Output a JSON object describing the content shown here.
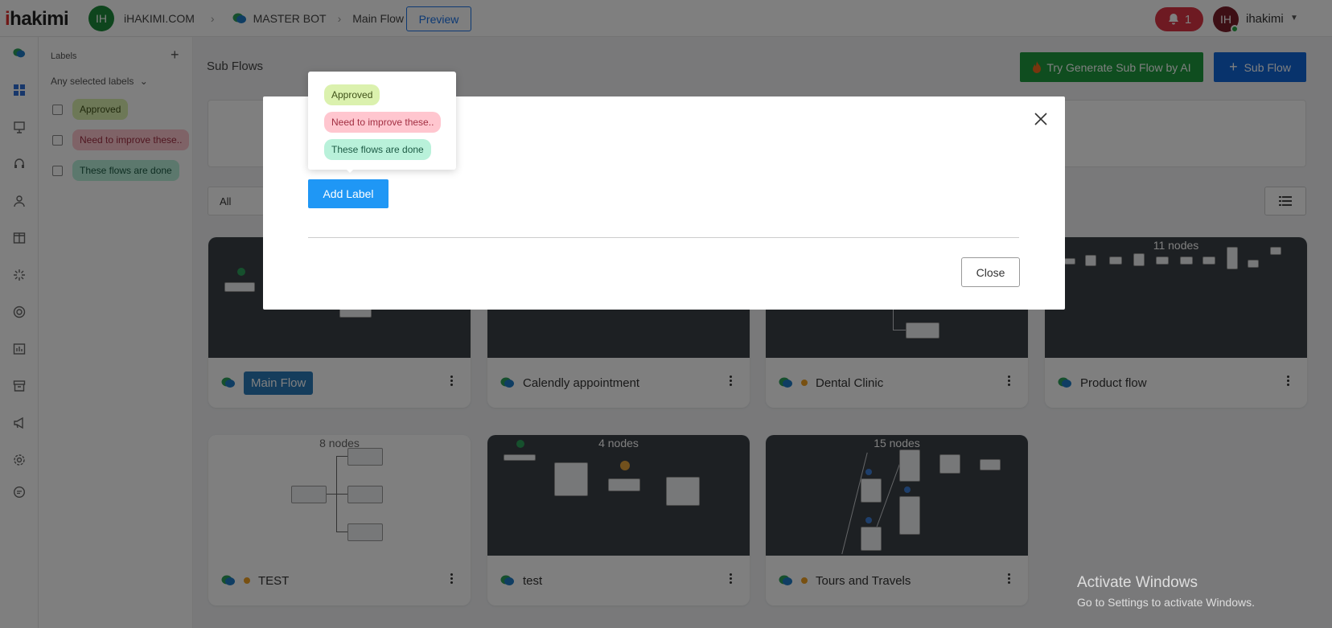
{
  "header": {
    "logo_prefix": "i",
    "logo_rest": "hakimi",
    "workspace_initials": "IH",
    "workspace_name": "iHAKIMI.COM",
    "bot_name": "MASTER BOT",
    "flow_name": "Main Flow",
    "preview_label": "Preview",
    "notification_count": "1",
    "user_initials": "IH",
    "user_name": "ihakimi"
  },
  "labels_panel": {
    "title": "Labels",
    "add": "+",
    "filter_placeholder": "Any selected labels",
    "items": [
      {
        "label": "Approved",
        "color": "#dbf1ae"
      },
      {
        "label": "Need to improve these..",
        "color": "#ffc6cf"
      },
      {
        "label": "These flows are done",
        "color": "#b9f1da"
      }
    ]
  },
  "main": {
    "title": "Sub Flows",
    "ai_button": "Try Generate Sub Flow by AI",
    "sub_flow_button": "Sub Flow",
    "filter_value": "All"
  },
  "cards": [
    {
      "name": "Main Flow",
      "nodes": ""
    },
    {
      "name": "Calendly appointment",
      "nodes": ""
    },
    {
      "name": "Dental Clinic",
      "nodes": ""
    },
    {
      "name": "Product flow",
      "nodes": "11 nodes"
    },
    {
      "name": "TEST",
      "nodes": "8 nodes"
    },
    {
      "name": "test",
      "nodes": "4 nodes"
    },
    {
      "name": "Tours and Travels",
      "nodes": "15 nodes"
    }
  ],
  "modal": {
    "add_label_button": "Add Label",
    "close_button": "Close",
    "popover_labels": [
      "Approved",
      "Need to improve these..",
      "These flows are done"
    ]
  },
  "watermark": {
    "line1": "Activate Windows",
    "line2": "Go to Settings to activate Windows."
  },
  "colors": {
    "accent_blue": "#1167d8",
    "ai_green": "#1e9b3e",
    "notification_red": "#dc3545",
    "add_label_blue": "#1f97f5"
  }
}
